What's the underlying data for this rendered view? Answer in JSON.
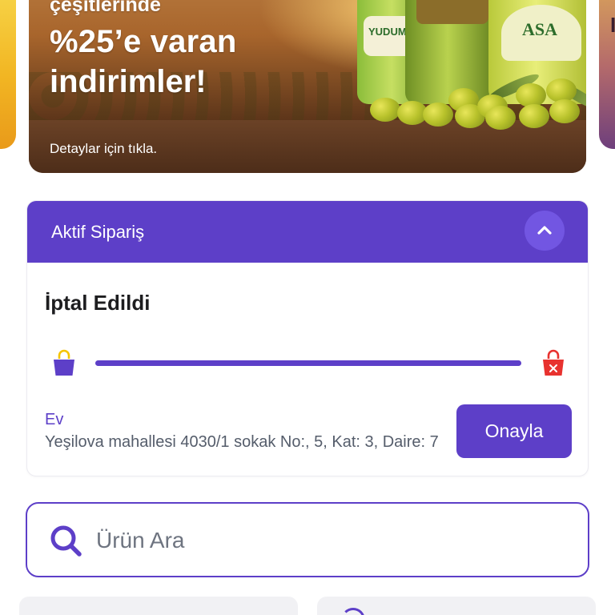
{
  "banner": {
    "headline_line1": "çeşitlerinde",
    "headline_line2": "%25’e varan",
    "headline_line3": "indirimler!",
    "cta": "Detaylar için tıkla.",
    "product_brands": [
      "YUDUM",
      "ASA"
    ]
  },
  "active_order": {
    "title": "Aktif Sipariş",
    "status": "İptal Edildi",
    "progress": 1.0,
    "address_label": "Ev",
    "address_text": "Yeşilova mahallesi 4030/1 sokak No:, 5, Kat: 3, Daire: 7",
    "confirm_label": "Onayla"
  },
  "search": {
    "placeholder": "Ürün Ara"
  },
  "colors": {
    "primary": "#5d3fc8",
    "primary_light": "#7256e2",
    "cancel_red": "#e8322f",
    "bag_yellow": "#f5c400"
  },
  "icons": {
    "collapse": "chevron-up-icon",
    "start_bag": "shopping-bag-icon",
    "end_bag": "cancelled-bag-icon",
    "search": "search-icon"
  }
}
